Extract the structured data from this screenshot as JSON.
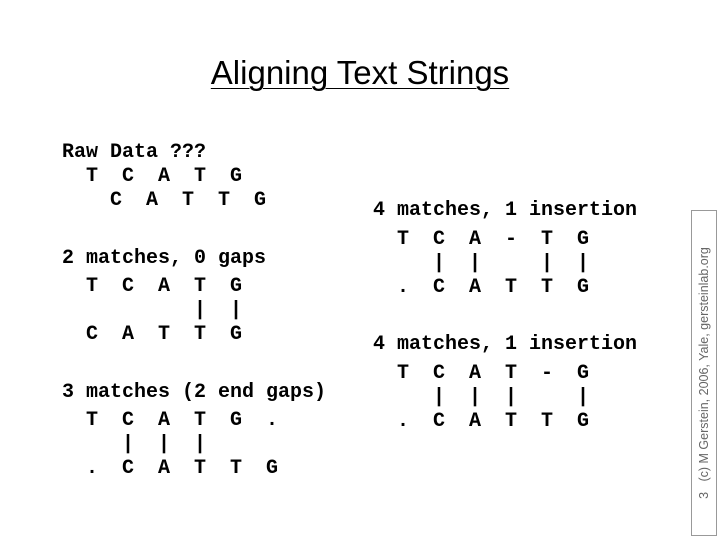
{
  "title": "Aligning Text Strings",
  "left": [
    {
      "text": "Raw Data ???"
    },
    {
      "text": "  T  C  A  T  G"
    },
    {
      "text": "    C  A  T  T  G"
    },
    {
      "text": "2 matches, 0 gaps"
    },
    {
      "text": "  T  C  A  T  G"
    },
    {
      "text": "           |  |"
    },
    {
      "text": "  C  A  T  T  G"
    },
    {
      "text": "3 matches (2 end gaps)"
    },
    {
      "text": "  T  C  A  T  G  ."
    },
    {
      "text": "     |  |  |"
    },
    {
      "text": "  .  C  A  T  T  G"
    }
  ],
  "right": [
    {
      "text": "4 matches, 1 insertion"
    },
    {
      "text": "  T  C  A  -  T  G"
    },
    {
      "text": "     |  |     |  |"
    },
    {
      "text": "  .  C  A  T  T  G"
    },
    {
      "text": "4 matches, 1 insertion"
    },
    {
      "text": "  T  C  A  T  -  G"
    },
    {
      "text": "     |  |  |     |"
    },
    {
      "text": "  .  C  A  T  T  G"
    }
  ],
  "footer": "3   (c) M Gerstein, 2006, Yale, gersteinlab.org"
}
